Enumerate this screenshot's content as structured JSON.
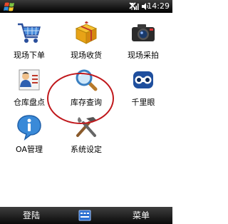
{
  "status_bar": {
    "time": "14:29"
  },
  "apps": [
    {
      "label": "现场下单",
      "icon": "shopping-cart-icon"
    },
    {
      "label": "现场收货",
      "icon": "gift-box-icon"
    },
    {
      "label": "现场采拍",
      "icon": "camera-icon"
    },
    {
      "label": "仓库盘点",
      "icon": "contact-card-icon"
    },
    {
      "label": "库存查询",
      "icon": "magnifier-icon"
    },
    {
      "label": "千里眼",
      "icon": "binoculars-icon"
    },
    {
      "label": "OA管理",
      "icon": "info-bubble-icon"
    },
    {
      "label": "系统设定",
      "icon": "tools-icon"
    }
  ],
  "softkeys": {
    "left": "登陆",
    "right": "菜单"
  },
  "colors": {
    "highlight": "#c0181c",
    "bar": "#1a1a1a"
  }
}
